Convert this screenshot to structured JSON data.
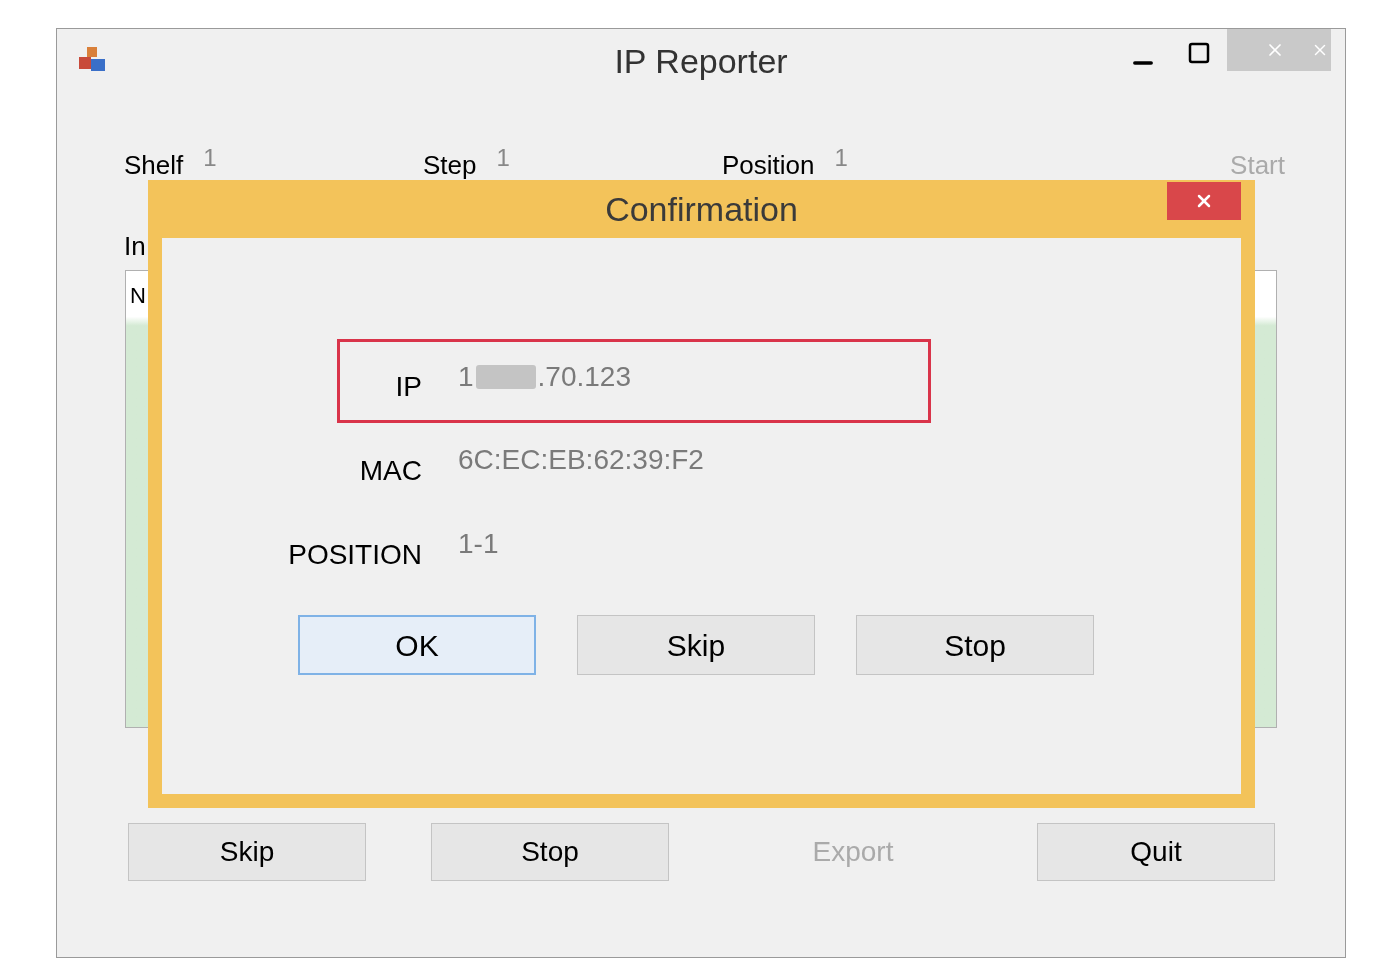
{
  "window": {
    "title": "IP Reporter"
  },
  "counters": [
    {
      "label": "Shelf",
      "value": "1"
    },
    {
      "label": "Step",
      "value": "1"
    },
    {
      "label": "Position",
      "value": "1"
    }
  ],
  "start_button": {
    "label": "Start",
    "disabled": true
  },
  "info_label": "In",
  "list": {
    "text": "N"
  },
  "buttons": [
    {
      "label": "Skip",
      "disabled": false
    },
    {
      "label": "Stop",
      "disabled": false
    },
    {
      "label": "Export",
      "disabled": true
    },
    {
      "label": "Quit",
      "disabled": false
    }
  ],
  "dialog": {
    "title": "Confirmation",
    "fields": [
      {
        "label": "IP",
        "value_before": "1",
        "value_after": ".70.123",
        "redacted": true,
        "highlighted": true
      },
      {
        "label": "MAC",
        "value": "6C:EC:EB:62:39:F2",
        "highlighted": false
      },
      {
        "label": "POSITION",
        "value": "1-1",
        "highlighted": false
      }
    ],
    "buttons": [
      {
        "label": "OK",
        "default": true
      },
      {
        "label": "Skip",
        "default": false
      },
      {
        "label": "Stop",
        "default": false
      }
    ]
  }
}
